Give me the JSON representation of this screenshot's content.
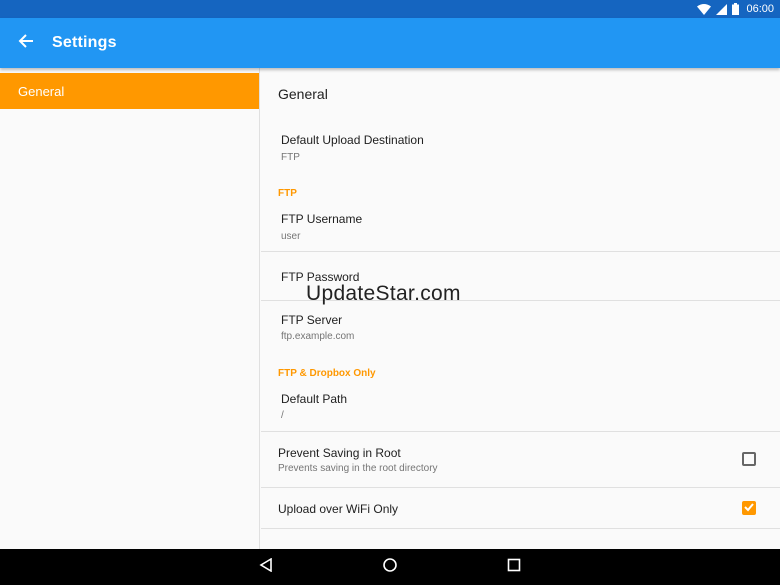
{
  "status_bar": {
    "time": "06:00"
  },
  "app_bar": {
    "title": "Settings"
  },
  "sidebar": {
    "items": [
      {
        "label": "General",
        "selected": true
      }
    ]
  },
  "content": {
    "section_title": "General",
    "default_upload": {
      "title": "Default Upload Destination",
      "summary": "FTP"
    },
    "cat_ftp": "FTP",
    "ftp_username": {
      "title": "FTP Username",
      "summary": "user"
    },
    "ftp_password": {
      "title": "FTP Password"
    },
    "ftp_server": {
      "title": "FTP Server",
      "summary": "ftp.example.com"
    },
    "cat_ftp_dropbox": "FTP & Dropbox Only",
    "default_path": {
      "title": "Default Path",
      "summary": "/"
    },
    "prevent_root": {
      "title": "Prevent Saving in Root",
      "summary": "Prevents saving in the root directory",
      "checked": false
    },
    "wifi_only": {
      "title": "Upload over WiFi Only",
      "checked": true
    }
  },
  "watermark": "UpdateStar.com",
  "colors": {
    "status_bar": "#1565c0",
    "app_bar": "#2196f3",
    "accent": "#ff9800",
    "nav_bar": "#000000"
  }
}
